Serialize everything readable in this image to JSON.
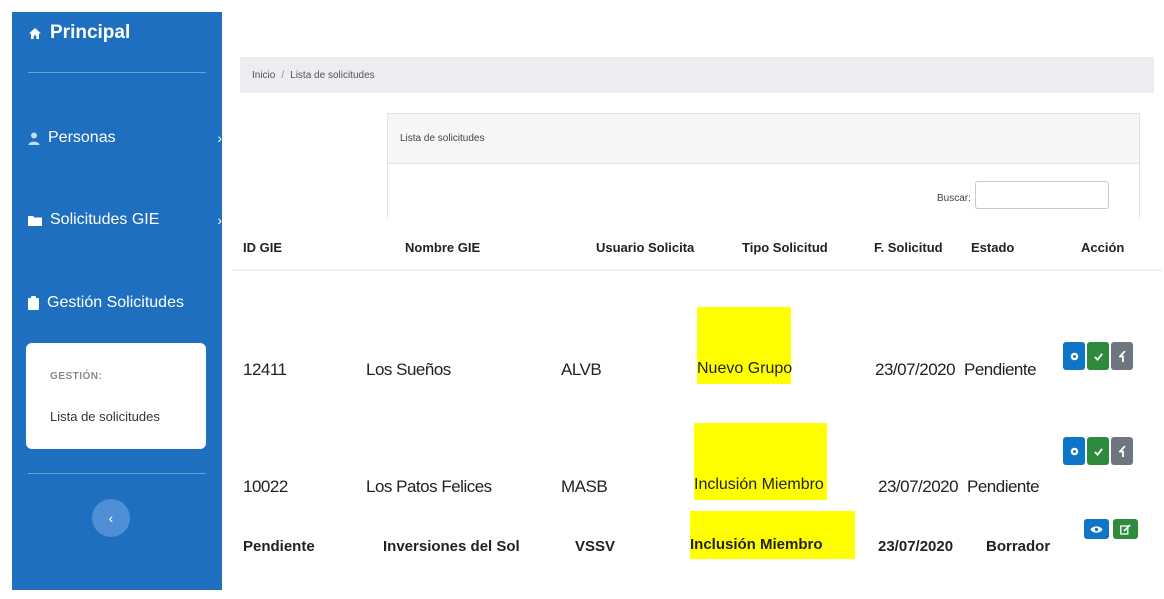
{
  "colors": {
    "sidebar": "#1f6fc0",
    "highlight": "#ffff00",
    "btn_blue": "#0f75c7",
    "btn_green": "#2e8b3e",
    "btn_gray": "#6e7680"
  },
  "sidebar": {
    "brand": "Principal",
    "items": [
      {
        "label": "Personas",
        "icon": "user-icon"
      },
      {
        "label": "Solicitudes GIE",
        "icon": "folder-icon"
      },
      {
        "label": "Gestión Solicitudes",
        "icon": "clipboard-icon"
      }
    ],
    "submenu": {
      "caption": "GESTIÓN:",
      "link": "Lista de solicitudes"
    },
    "toggle": "‹"
  },
  "breadcrumb": {
    "home": "Inicio",
    "separator": "/",
    "current": "Lista de solicitudes"
  },
  "panel": {
    "title": "Lista de solicitudes",
    "search_label": "Buscar:",
    "search_value": ""
  },
  "table": {
    "headers": [
      "ID GIE",
      "Nombre GIE",
      "Usuario Solicita",
      "Tipo Solicitud",
      "F. Solicitud",
      "Estado",
      "Acción"
    ],
    "rows": [
      {
        "id": "12411",
        "name": "Los Sueños",
        "user": "ALVB",
        "type": "Nuevo Grupo",
        "date": "23/07/2020",
        "status": "Pendiente",
        "actions": [
          "view",
          "approve",
          "back"
        ]
      },
      {
        "id": "10022",
        "name": "Los Patos Felices",
        "user": "MASB",
        "type": "Inclusión Miembro",
        "date": "23/07/2020",
        "status": "Pendiente",
        "actions": [
          "view",
          "approve",
          "back"
        ]
      },
      {
        "id": "Pendiente",
        "name": "Inversiones del Sol",
        "user": "VSSV",
        "type": "Inclusión Miembro",
        "date": "23/07/2020",
        "status": "Borrador",
        "actions": [
          "eye",
          "edit"
        ]
      }
    ]
  }
}
